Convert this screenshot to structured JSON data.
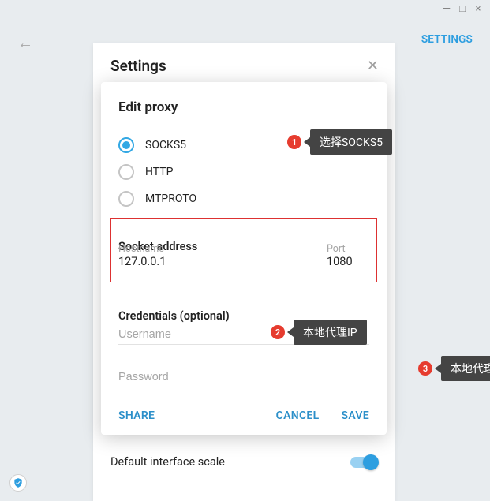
{
  "window": {
    "back_settings_title": "Settings",
    "settings_link": "SETTINGS",
    "interface_scale_label": "Default interface scale"
  },
  "modal": {
    "title": "Edit proxy",
    "proxy_types": {
      "socks5": "SOCKS5",
      "http": "HTTP",
      "mtproto": "MTPROTO"
    },
    "socket_label": "Socket address",
    "hostname_label": "Hostname",
    "hostname_value": "127.0.0.1",
    "port_label": "Port",
    "port_value": "1080",
    "creds_label": "Credentials (optional)",
    "username_placeholder": "Username",
    "password_placeholder": "Password",
    "share": "SHARE",
    "cancel": "CANCEL",
    "save": "SAVE"
  },
  "callouts": {
    "c1_num": "1",
    "c1_text": "选择SOCKS5",
    "c2_num": "2",
    "c2_text": "本地代理IP",
    "c3_num": "3",
    "c3_text": "本地代理默认端口"
  }
}
